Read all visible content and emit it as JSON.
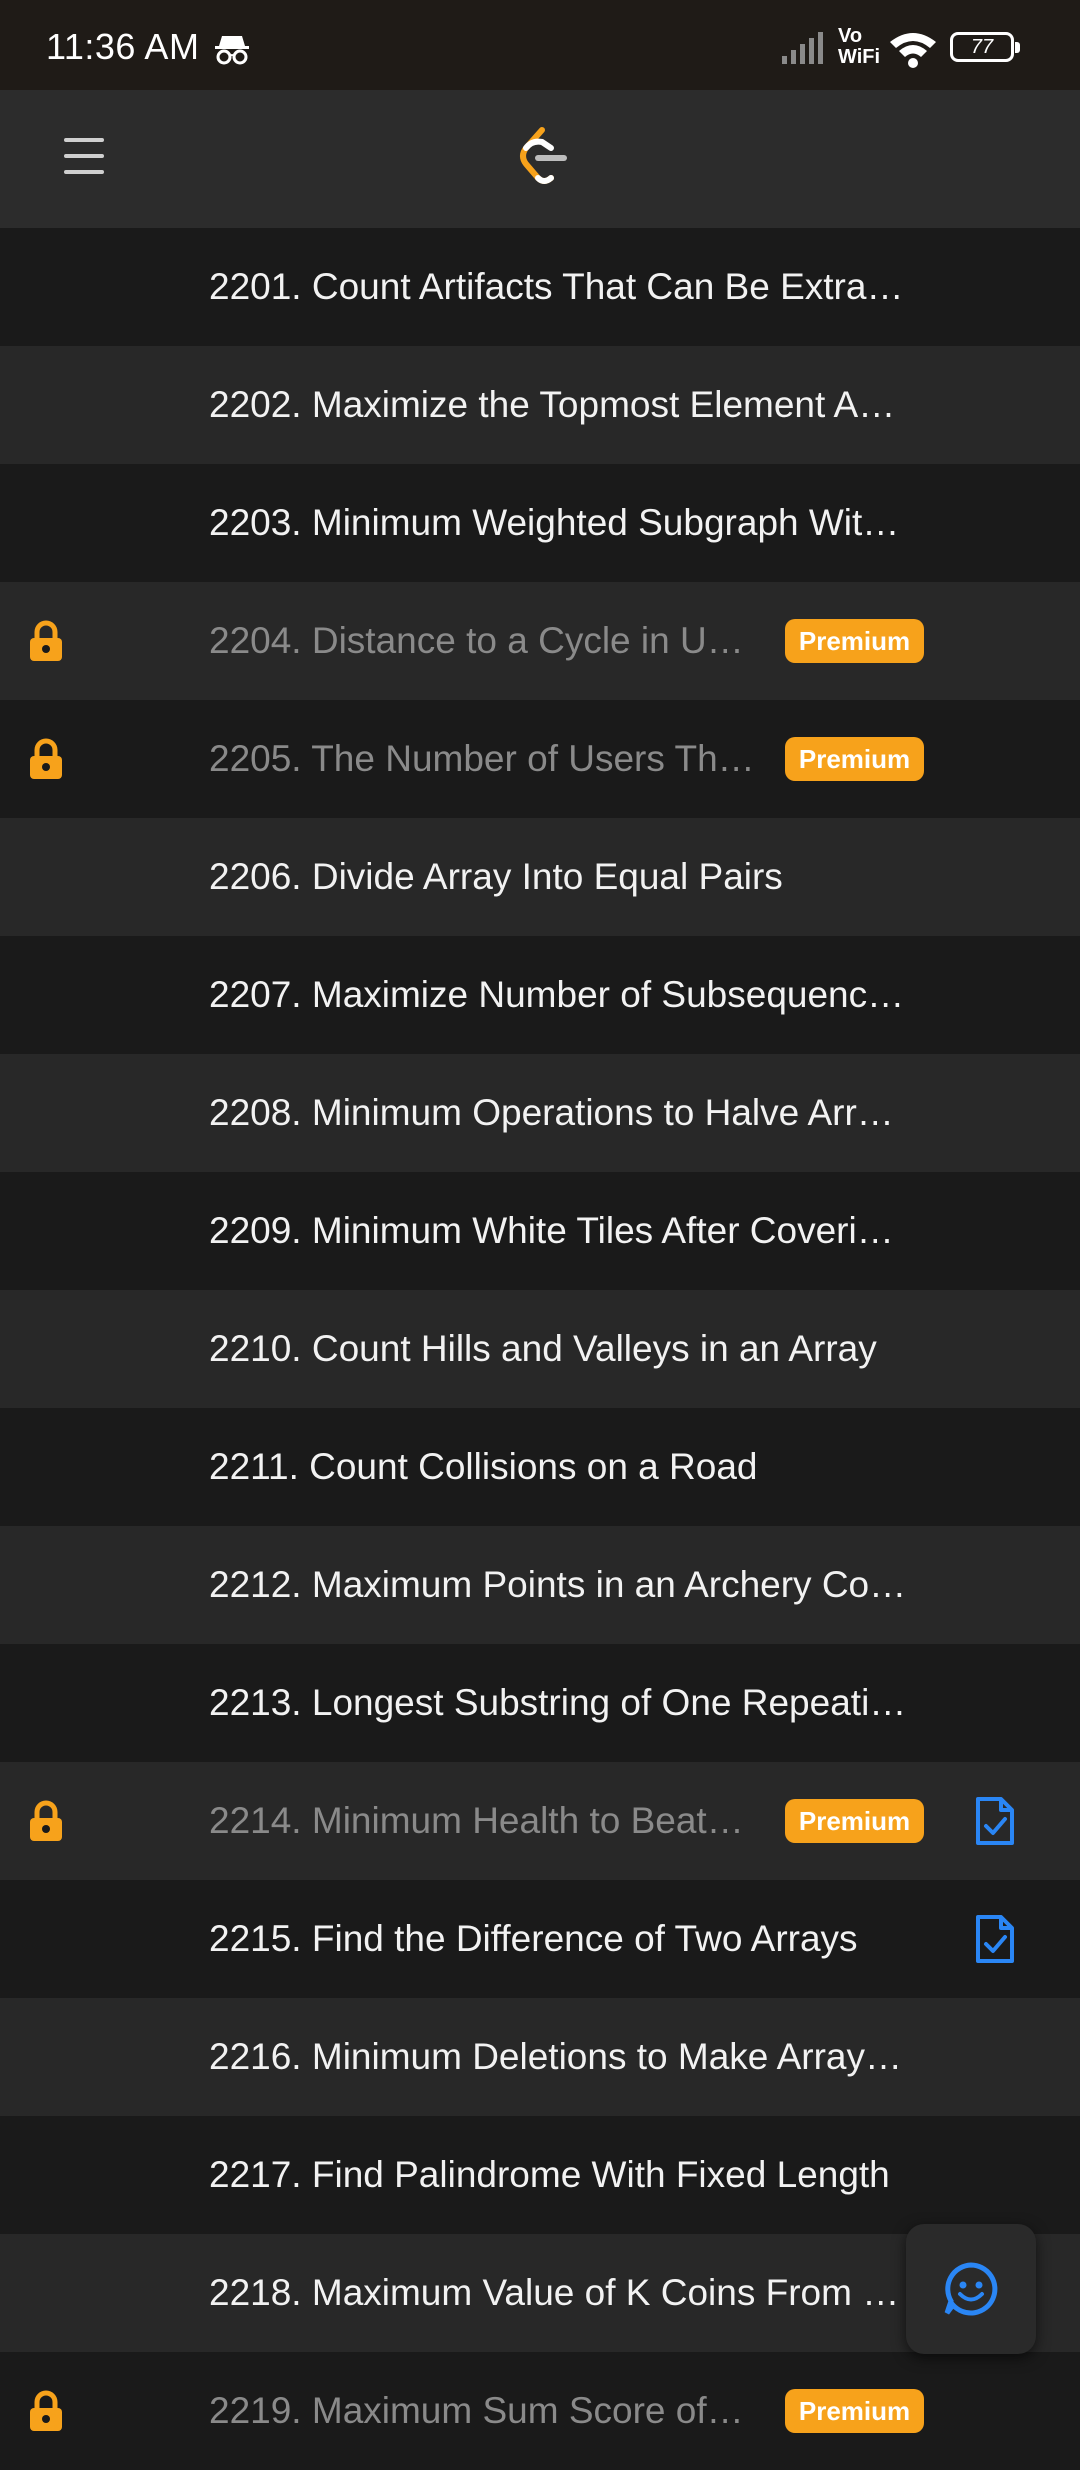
{
  "status_bar": {
    "time": "11:36 AM",
    "vowifi_top": "Vo",
    "vowifi_bottom": "WiFi",
    "battery": "77"
  },
  "header": {
    "menu_icon": "hamburger-icon",
    "logo_icon": "leetcode-logo"
  },
  "colors": {
    "premium_badge": "#f7a21b",
    "lock": "#f7a21b",
    "doc_icon": "#2a86f5"
  },
  "problems": [
    {
      "title": "2201. Count Artifacts That Can Be Extra…",
      "locked": false
    },
    {
      "title": "2202. Maximize the Topmost Element A…",
      "locked": false
    },
    {
      "title": "2203. Minimum Weighted Subgraph Wit…",
      "locked": false
    },
    {
      "title": "2204. Distance to a Cycle in U…",
      "locked": true,
      "badge": "Premium"
    },
    {
      "title": "2205. The Number of Users Th…",
      "locked": true,
      "badge": "Premium"
    },
    {
      "title": "2206. Divide Array Into Equal Pairs",
      "locked": false
    },
    {
      "title": "2207. Maximize Number of Subsequenc…",
      "locked": false
    },
    {
      "title": "2208. Minimum Operations to Halve Arr…",
      "locked": false
    },
    {
      "title": "2209. Minimum White Tiles After Coveri…",
      "locked": false
    },
    {
      "title": "2210. Count Hills and Valleys in an Array",
      "locked": false
    },
    {
      "title": "2211. Count Collisions on a Road",
      "locked": false
    },
    {
      "title": "2212. Maximum Points in an Archery Co…",
      "locked": false
    },
    {
      "title": "2213. Longest Substring of One Repeati…",
      "locked": false
    },
    {
      "title": "2214. Minimum Health to Beat…",
      "locked": true,
      "badge": "Premium",
      "solution_icon": true
    },
    {
      "title": "2215. Find the Difference of Two Arrays",
      "locked": false,
      "solution_icon": true
    },
    {
      "title": "2216. Minimum Deletions to Make Array…",
      "locked": false
    },
    {
      "title": "2217. Find Palindrome With Fixed Length",
      "locked": false
    },
    {
      "title": "2218. Maximum Value of K Coins From …",
      "locked": false
    },
    {
      "title": "2219. Maximum Sum Score of…",
      "locked": true,
      "badge": "Premium"
    }
  ],
  "fab": {
    "icon": "smiley-feedback-icon"
  }
}
